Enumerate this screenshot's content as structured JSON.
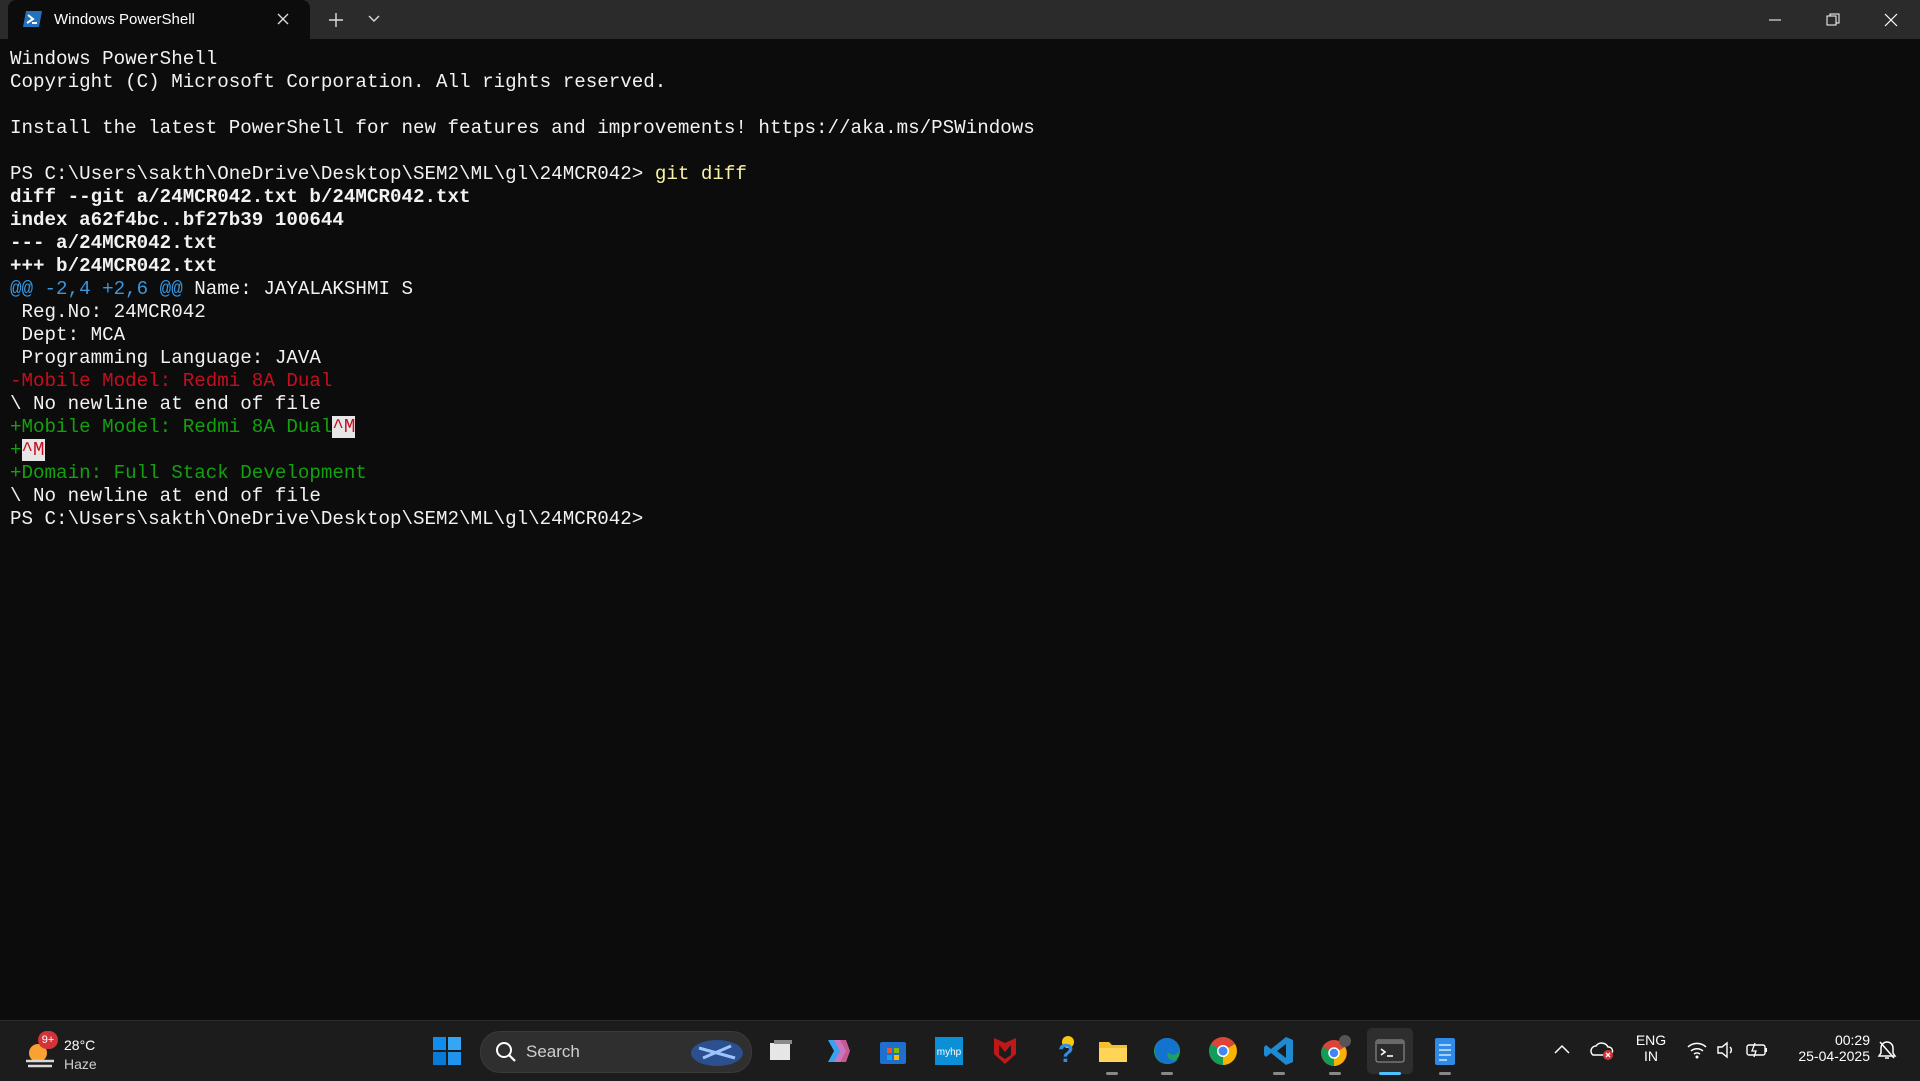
{
  "window": {
    "tab_title": "Windows PowerShell",
    "controls": [
      "minimize",
      "restore",
      "close"
    ]
  },
  "terminal": {
    "lines": [
      {
        "text": "Windows PowerShell",
        "style": "white"
      },
      {
        "text": "Copyright (C) Microsoft Corporation. All rights reserved.",
        "style": "white"
      },
      {
        "text": "",
        "style": "white"
      },
      {
        "text": "Install the latest PowerShell for new features and improvements! https://aka.ms/PSWindows",
        "style": "white"
      },
      {
        "text": "",
        "style": "white"
      },
      {
        "prompt": "PS C:\\Users\\sakth\\OneDrive\\Desktop\\SEM2\\ML\\gl\\24MCR042> ",
        "command": "git diff",
        "style": "prompt"
      },
      {
        "text": "diff --git a/24MCR042.txt b/24MCR042.txt",
        "style": "bold"
      },
      {
        "text": "index a62f4bc..bf27b39 100644",
        "style": "bold"
      },
      {
        "text": "--- a/24MCR042.txt",
        "style": "bold"
      },
      {
        "text": "+++ b/24MCR042.txt",
        "style": "bold"
      },
      {
        "hunk": "@@ -2,4 +2,6 @@",
        "text": " Name: JAYALAKSHMI S",
        "style": "hunk"
      },
      {
        "text": " Reg.No: 24MCR042",
        "style": "white"
      },
      {
        "text": " Dept: MCA",
        "style": "white"
      },
      {
        "text": " Programming Language: JAVA",
        "style": "white"
      },
      {
        "text": "-Mobile Model: Redmi 8A Dual",
        "style": "red"
      },
      {
        "text": "\\ No newline at end of file",
        "style": "white"
      },
      {
        "text": "+Mobile Model: Redmi 8A Dual",
        "caret": "^M",
        "style": "green"
      },
      {
        "text": "+",
        "caret": "^M",
        "style": "green"
      },
      {
        "text": "+Domain: Full Stack Development",
        "style": "green"
      },
      {
        "text": "\\ No newline at end of file",
        "style": "white"
      },
      {
        "prompt": "PS C:\\Users\\sakth\\OneDrive\\Desktop\\SEM2\\ML\\gl\\24MCR042> ",
        "command": "",
        "style": "prompt"
      }
    ]
  },
  "taskbar": {
    "weather": {
      "temp": "28°C",
      "desc": "Haze",
      "badge": "9+"
    },
    "search_placeholder": "Search",
    "apps": [
      "windows-start",
      "search",
      "task-view",
      "copilot",
      "microsoft-store",
      "myhp",
      "mcafee",
      "get-help",
      "file-explorer",
      "edge",
      "chrome",
      "vscode",
      "chrome-profile",
      "terminal",
      "notepad"
    ],
    "tray": {
      "lang_line1": "ENG",
      "lang_line2": "IN",
      "time": "00:29",
      "date": "25-04-2025"
    }
  }
}
